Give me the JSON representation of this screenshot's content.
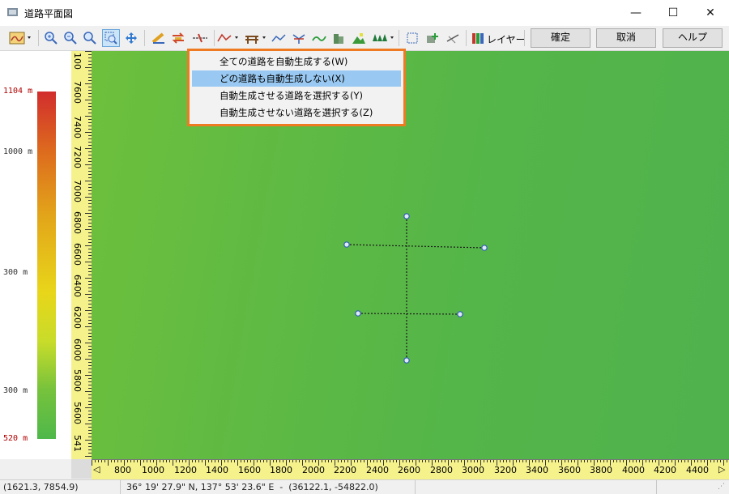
{
  "window": {
    "title": "道路平面図",
    "minimize_glyph": "—",
    "maximize_glyph": "☐",
    "close_glyph": "✕"
  },
  "toolbar": {
    "layer_button": "レイヤー",
    "ok_button": "確定",
    "cancel_button": "取消",
    "help_button": "ヘルプ"
  },
  "road_menu": {
    "items": [
      {
        "label": "全ての道路を自動生成する(W)",
        "selected": false
      },
      {
        "label": "どの道路も自動生成しない(X)",
        "selected": true
      },
      {
        "label": "自動生成させる道路を選択する(Y)",
        "selected": false
      },
      {
        "label": "自動生成させない道路を選択する(Z)",
        "selected": false
      }
    ]
  },
  "legend": {
    "max_label": "1104 m",
    "label_1000": "1000 m",
    "label_mid": "300 m",
    "label_low": "300 m",
    "min_label": "520 m"
  },
  "y_ruler": [
    "7600",
    "7400",
    "7200",
    "7000",
    "6800",
    "6600",
    "6400",
    "6200",
    "6000",
    "5800",
    "5600"
  ],
  "y_ruler_top_partial": "100",
  "y_ruler_bottom_partial": "541",
  "x_ruler": [
    "800",
    "1000",
    "1200",
    "1400",
    "1600",
    "1800",
    "2000",
    "2200",
    "2400",
    "2600",
    "2800",
    "3000",
    "3200",
    "3400",
    "3600",
    "3800",
    "4000",
    "4200",
    "4400"
  ],
  "status": {
    "cursor_coords": "(1621.3, 7854.9)",
    "geo_coords": "36° 19' 27.9\" N, 137° 53' 23.6\" E  -  (36122.1, -54822.0)"
  },
  "colors": {
    "accent_highlight": "#ee7b22",
    "menu_selected": "#99c9f2",
    "road_line": "#1a1a1a",
    "node": "#2f5fb8"
  }
}
